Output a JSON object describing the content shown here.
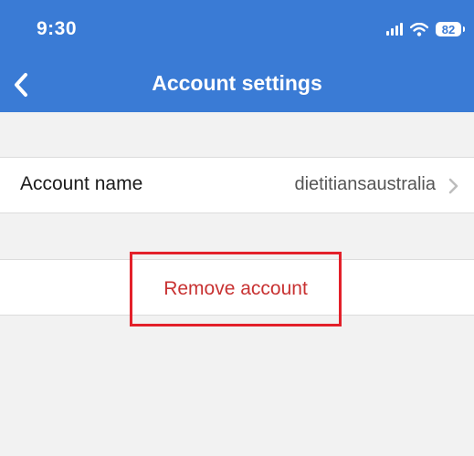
{
  "status_bar": {
    "time": "9:30",
    "battery": "82",
    "icons": [
      "signal-icon",
      "wifi-icon",
      "battery-icon"
    ]
  },
  "nav": {
    "back_icon": "chevron-left-icon",
    "title": "Account settings"
  },
  "settings": {
    "account_name_label": "Account name",
    "account_name_value": "dietitiansaustralia",
    "chevron_icon": "chevron-right-icon"
  },
  "actions": {
    "remove_label": "Remove account"
  },
  "colors": {
    "header": "#3a7bd5",
    "background": "#f2f2f2",
    "destructive_text": "#c83232",
    "highlight_border": "#e3202a"
  }
}
